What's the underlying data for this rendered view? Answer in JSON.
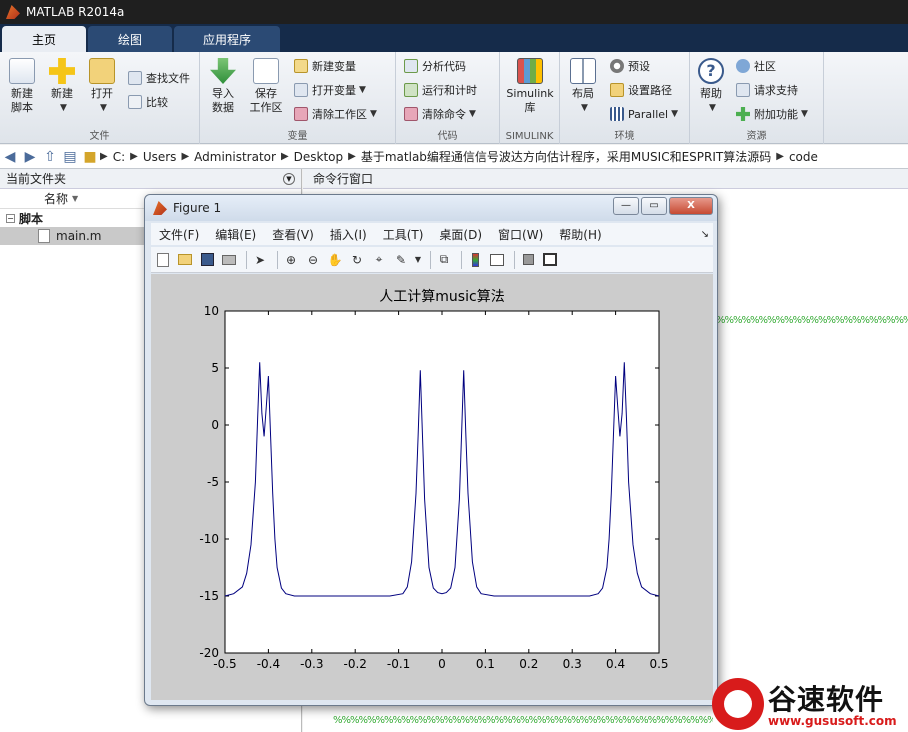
{
  "app": {
    "title": "MATLAB R2014a"
  },
  "tabs": [
    {
      "label": "主页",
      "active": true
    },
    {
      "label": "绘图"
    },
    {
      "label": "应用程序"
    }
  ],
  "ribbon": {
    "groups": [
      {
        "label": "文件",
        "big": [
          "新建\n脚本",
          "新建",
          "打开"
        ],
        "small": [
          "查找文件",
          "比较"
        ]
      },
      {
        "label": "变量",
        "big": [
          "导入\n数据",
          "保存\n工作区"
        ],
        "small": [
          "新建变量",
          "打开变量",
          "清除工作区"
        ]
      },
      {
        "label": "代码",
        "small": [
          "分析代码",
          "运行和计时",
          "清除命令"
        ]
      },
      {
        "label": "SIMULINK",
        "big": [
          "Simulink\n库"
        ]
      },
      {
        "label": "环境",
        "big": [
          "布局"
        ],
        "small": [
          "预设",
          "设置路径",
          "Parallel"
        ]
      },
      {
        "label": "资源",
        "big": [
          "帮助"
        ],
        "small": [
          "社区",
          "请求支持",
          "附加功能"
        ]
      }
    ]
  },
  "address": {
    "crumbs": [
      "C:",
      "Users",
      "Administrator",
      "Desktop",
      "基于matlab编程通信信号波达方向估计程序，采用MUSIC和ESPRIT算法源码",
      "code"
    ]
  },
  "left_panel": {
    "title": "当前文件夹",
    "column": "名称",
    "section": "脚本",
    "file": "main.m"
  },
  "command": {
    "title": "命令行窗口",
    "pct_line": "%%%%%%%%%%%%%%%%%%%%%%%%%%%%%%%%%%%%%%%%%%%%%%%%%%%%%%%%%%%%%"
  },
  "figure": {
    "title": "Figure 1",
    "menus": [
      "文件(F)",
      "编辑(E)",
      "查看(V)",
      "插入(I)",
      "工具(T)",
      "桌面(D)",
      "窗口(W)",
      "帮助(H)"
    ],
    "min_label": "—",
    "max_label": "▭",
    "close_label": "X"
  },
  "chart_data": {
    "type": "line",
    "title": "人工计算music算法",
    "xlabel": "",
    "ylabel": "",
    "xlim": [
      -0.5,
      0.5
    ],
    "ylim": [
      -20,
      10
    ],
    "xticks": [
      "-0.5",
      "-0.4",
      "-0.3",
      "-0.2",
      "-0.1",
      "0",
      "0.1",
      "0.2",
      "0.3",
      "0.4",
      "0.5"
    ],
    "yticks": [
      "10",
      "5",
      "0",
      "-5",
      "-10",
      "-15",
      "-20"
    ],
    "line_color": "#00007f",
    "series": [
      {
        "x": [
          -0.5,
          -0.48,
          -0.46,
          -0.45,
          -0.44,
          -0.43,
          -0.425,
          -0.42,
          -0.415,
          -0.41,
          -0.405,
          -0.4,
          -0.395,
          -0.39,
          -0.385,
          -0.38,
          -0.37,
          -0.36,
          -0.34,
          -0.3,
          -0.2,
          -0.12,
          -0.09,
          -0.08,
          -0.07,
          -0.06,
          -0.055,
          -0.05,
          -0.045,
          -0.04,
          -0.03,
          -0.02,
          -0.01,
          0,
          0.01,
          0.02,
          0.03,
          0.04,
          0.045,
          0.05,
          0.055,
          0.06,
          0.07,
          0.08,
          0.09,
          0.12,
          0.2,
          0.3,
          0.34,
          0.36,
          0.37,
          0.38,
          0.385,
          0.39,
          0.395,
          0.4,
          0.405,
          0.41,
          0.415,
          0.42,
          0.425,
          0.43,
          0.44,
          0.45,
          0.46,
          0.48,
          0.5
        ],
        "y": [
          -15,
          -14.8,
          -14.2,
          -13.0,
          -10.5,
          -5.0,
          0.5,
          5.5,
          1.0,
          -1.0,
          1.5,
          4.3,
          -1.0,
          -6.0,
          -10.0,
          -12.5,
          -14.3,
          -14.8,
          -15,
          -15,
          -15,
          -15,
          -14.8,
          -14.2,
          -12.0,
          -6.0,
          -1.0,
          4.8,
          -1.0,
          -6.5,
          -12.5,
          -14.3,
          -14.7,
          -14.8,
          -14.7,
          -14.3,
          -12.5,
          -6.5,
          -1.0,
          4.8,
          -1.0,
          -6.0,
          -12.0,
          -14.2,
          -14.8,
          -15,
          -15,
          -15,
          -15,
          -14.8,
          -14.3,
          -12.5,
          -10.0,
          -6.0,
          -1.0,
          4.3,
          1.5,
          -1.0,
          1.0,
          5.5,
          0.5,
          -5.0,
          -10.5,
          -13.0,
          -14.2,
          -14.8,
          -15
        ]
      }
    ]
  },
  "watermark": {
    "text": "谷速软件",
    "url": "www.gususoft.com"
  }
}
